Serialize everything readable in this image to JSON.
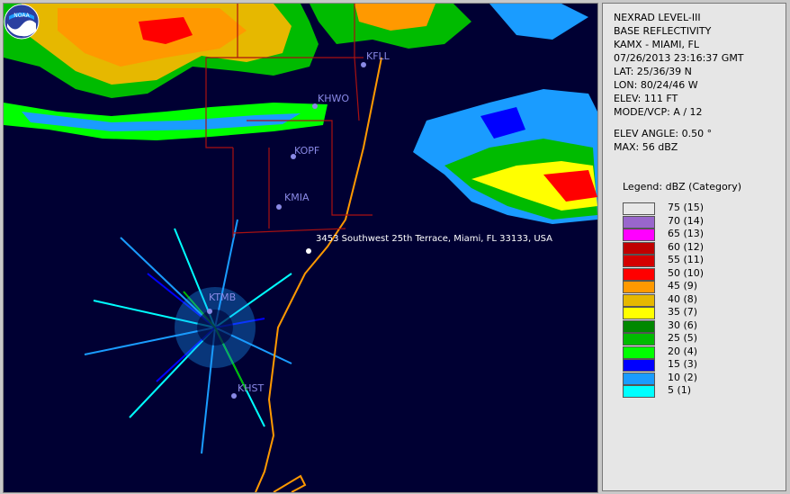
{
  "header": {
    "product": "NEXRAD LEVEL-III",
    "type": "BASE REFLECTIVITY",
    "station": "KAMX - MIAMI, FL",
    "datetime": "07/26/2013 23:16:37 GMT",
    "lat": "LAT: 25/36/39 N",
    "lon": "LON: 80/24/46 W",
    "elev": "ELEV: 111 FT",
    "mode": "MODE/VCP: A / 12",
    "elev_angle": "ELEV ANGLE: 0.50 °",
    "max": "MAX: 56 dBZ"
  },
  "legend": {
    "title": "Legend: dBZ (Category)",
    "items": [
      {
        "label": "75  (15)",
        "color": "#e8e8e8"
      },
      {
        "label": "70  (14)",
        "color": "#9966cc"
      },
      {
        "label": "65  (13)",
        "color": "#ff00ff"
      },
      {
        "label": "60  (12)",
        "color": "#c00000"
      },
      {
        "label": "55  (11)",
        "color": "#d40000"
      },
      {
        "label": "50  (10)",
        "color": "#ff0000"
      },
      {
        "label": "45  (9)",
        "color": "#ff9900"
      },
      {
        "label": "40  (8)",
        "color": "#e6b800"
      },
      {
        "label": "35  (7)",
        "color": "#ffff00"
      },
      {
        "label": "30  (6)",
        "color": "#008800"
      },
      {
        "label": "25  (5)",
        "color": "#00bb00"
      },
      {
        "label": "20  (4)",
        "color": "#00ff00"
      },
      {
        "label": "15  (3)",
        "color": "#0000ff"
      },
      {
        "label": "10  (2)",
        "color": "#1a9cff"
      },
      {
        "label": "5  (1)",
        "color": "#00ffff"
      }
    ]
  },
  "stations": [
    "KFLL",
    "KHWO",
    "KOPF",
    "KMIA",
    "KTMB",
    "KHST"
  ],
  "address": "3453 Southwest 25th Terrace, Miami, FL 33133, USA",
  "logo": "NOAA"
}
